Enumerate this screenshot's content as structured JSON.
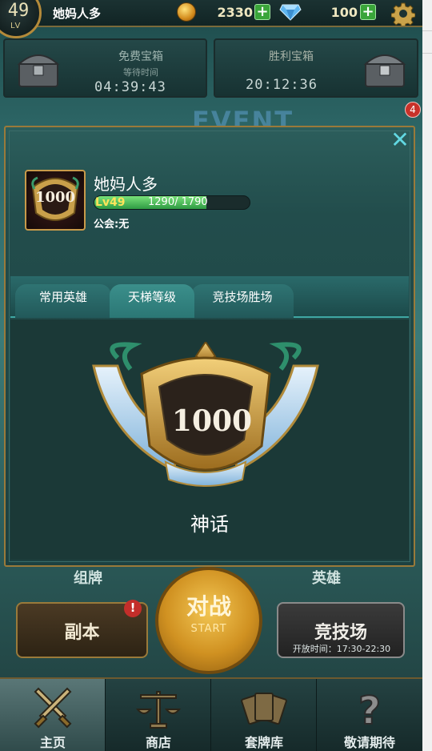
{
  "topbar": {
    "level": "49",
    "level_tag": "LV",
    "player_name": "她妈人多",
    "coins": "2330",
    "gems": "100"
  },
  "chests": {
    "free": {
      "title": "免费宝箱",
      "subtitle": "等待时间",
      "time": "04:39:43"
    },
    "victory": {
      "title": "胜利宝箱",
      "time": "20:12:36"
    }
  },
  "background": {
    "event_text": "EVENT",
    "notification_count": "4"
  },
  "profile_modal": {
    "avatar_score": "1000",
    "player_name": "她妈人多",
    "level_label": "Lv49",
    "xp_text": "1290/ 1790",
    "xp_progress": 0.72,
    "guild_text": "公会:无",
    "tabs": [
      "常用英雄",
      "天梯等级",
      "竞技场胜场"
    ],
    "selected_tab": 1,
    "rank_score": "1000",
    "rank_name": "神话"
  },
  "main_menu": {
    "deck_label": "组牌",
    "hero_label": "英雄",
    "dungeon_label": "副本",
    "dungeon_alert": "!",
    "battle_label": "对战",
    "battle_sub": "START",
    "arena_label": "竞技场",
    "arena_time": "开放时间：17:30-22:30"
  },
  "bottom_nav": [
    "主页",
    "商店",
    "套牌库",
    "敬请期待"
  ],
  "colors": {
    "accent_cyan": "#62d8e2",
    "gold": "#b48a3a",
    "xp_green": "#2f9b43",
    "alert_red": "#c32e2a"
  }
}
